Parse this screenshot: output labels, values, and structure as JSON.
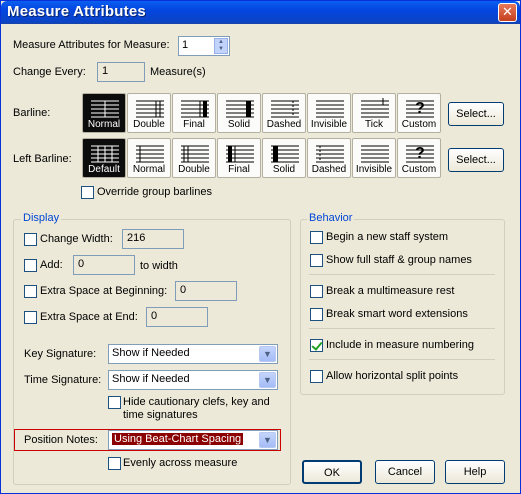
{
  "window": {
    "title": "Measure Attributes",
    "close_glyph": "✕"
  },
  "header": {
    "measure_for_label": "Measure Attributes for Measure:",
    "measure_value": "1",
    "change_every_label": "Change Every:",
    "change_every_value": "1",
    "measures_suffix": "Measure(s)"
  },
  "barline": {
    "label": "Barline:",
    "options": [
      "Normal",
      "Double",
      "Final",
      "Solid",
      "Dashed",
      "Invisible",
      "Tick",
      "Custom"
    ],
    "selected": "Normal",
    "select_button": "Select..."
  },
  "left_barline": {
    "label": "Left Barline:",
    "options": [
      "Default",
      "Normal",
      "Double",
      "Final",
      "Solid",
      "Dashed",
      "Invisible",
      "Custom"
    ],
    "selected": "Default",
    "select_button": "Select...",
    "override_label": "Override group barlines"
  },
  "display": {
    "title": "Display",
    "change_width_label": "Change Width:",
    "change_width_value": "216",
    "add_label": "Add:",
    "add_value": "0",
    "to_width": "to width",
    "extra_begin_label": "Extra Space at Beginning:",
    "extra_begin_value": "0",
    "extra_end_label": "Extra Space at End:",
    "extra_end_value": "0",
    "key_sig_label": "Key Signature:",
    "key_sig_value": "Show if Needed",
    "time_sig_label": "Time Signature:",
    "time_sig_value": "Show if Needed",
    "hide_cautionary_line1": "Hide cautionary clefs, key and",
    "hide_cautionary_line2": "time signatures",
    "position_notes_label": "Position Notes:",
    "position_notes_value": "Using Beat-Chart Spacing",
    "evenly_label": "Evenly across measure"
  },
  "behavior": {
    "title": "Behavior",
    "begin_new_system": "Begin a new staff system",
    "show_full_staff": "Show full staff & group names",
    "break_multimeasure": "Break a multimeasure rest",
    "break_smart_word": "Break smart word extensions",
    "include_numbering": "Include in measure numbering",
    "include_numbering_checked": true,
    "allow_split": "Allow horizontal split points"
  },
  "footer": {
    "ok": "OK",
    "cancel": "Cancel",
    "help": "Help"
  },
  "colors": {
    "accent": "#0046d5",
    "highlight_select": "#8b0000",
    "highlight_border": "#cc0000"
  }
}
